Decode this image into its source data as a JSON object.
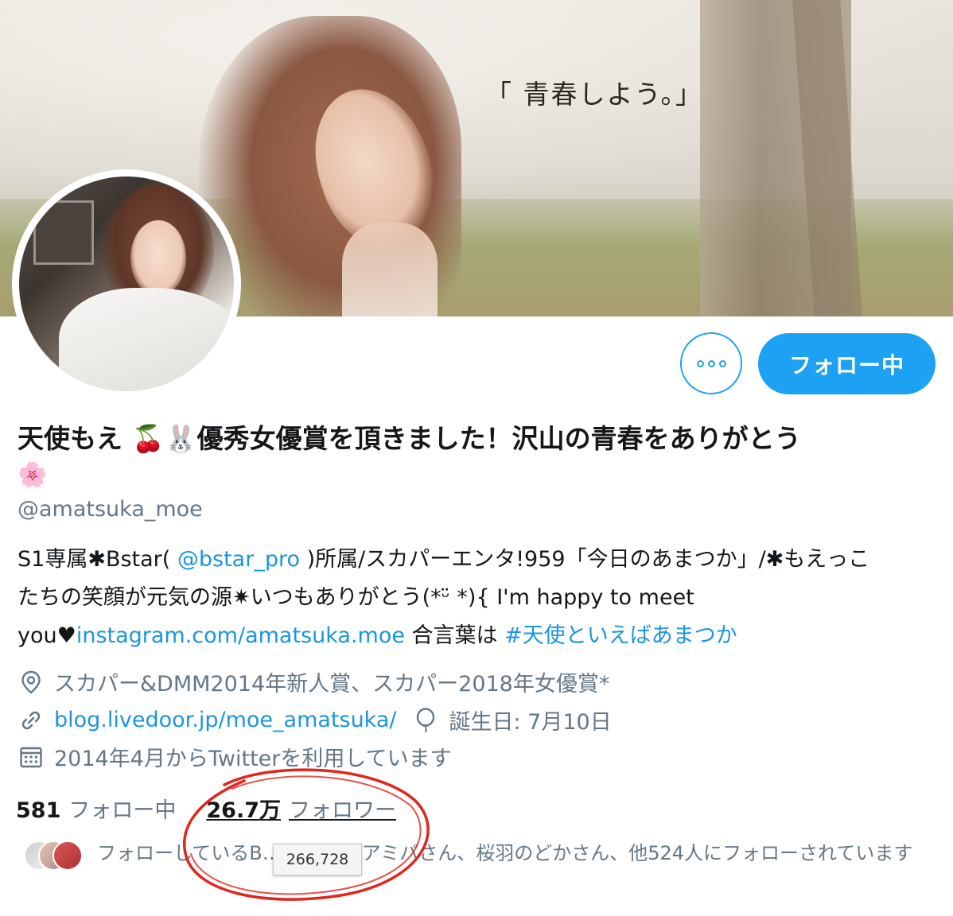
{
  "banner": {
    "quote": "「 青春しよう。」"
  },
  "actions": {
    "follow_label": "フォロー中",
    "more_icon": "more-dots-icon"
  },
  "profile": {
    "display_name": "天使もえ 🍒🐰優秀女優賞を頂きました！沢山の青春をありがとう",
    "display_name_line2": "🌸",
    "handle": "@amatsuka_moe"
  },
  "bio": {
    "l1_a": "S1専属✱Bstar( ",
    "l1_mention": "@bstar_pro",
    "l1_b": " )所属/スカパーエンタ!959「今日のあまつか」/✱もえっこ",
    "l2": "たちの笑顔が元気の源✷いつもありがとう(*ᵕ̈ *){ I'm happy to meet",
    "l3_a": "you♥",
    "l3_link": "instagram.com/amatsuka.moe",
    "l3_b": " 合言葉は ",
    "l3_hashtag": "#天使といえばあまつか"
  },
  "meta": {
    "location": "スカパー&DMM2014年新人賞、スカパー2018年女優賞*",
    "website": "blog.livedoor.jp/moe_amatsuka/",
    "birthday": "誕生日: 7月10日",
    "joined": "2014年4月からTwitterを利用しています"
  },
  "stats": {
    "following_count": "581",
    "following_label": "フォロー中",
    "followers_count": "26.7万",
    "followers_label": "フォロワー",
    "followers_tooltip": "266,728"
  },
  "followed_by": {
    "text": "フォローしているB… ージャーアミバさん、桜羽のどかさん、他524人にフォローされています"
  },
  "colors": {
    "accent": "#1da1f2",
    "link": "#1b95e0",
    "muted": "#657786",
    "annotation": "#e0261d"
  }
}
